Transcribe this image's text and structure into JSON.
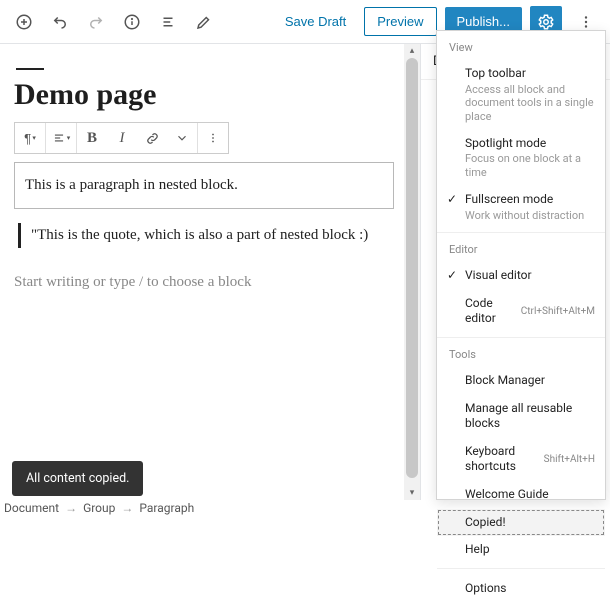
{
  "topbar": {
    "save_draft": "Save Draft",
    "preview": "Preview",
    "publish": "Publish..."
  },
  "editor": {
    "title": "Demo page",
    "paragraph": "This is a paragraph in nested block.",
    "quote": "\"This is the quote, which is also a part of nested block :)",
    "placeholder": "Start writing or type / to choose a block"
  },
  "toolbar": {
    "pilcrow": "¶",
    "bold": "B",
    "italic": "I"
  },
  "sidebar": {
    "tab": "D"
  },
  "menu": {
    "sections": {
      "view": {
        "heading": "View",
        "items": [
          {
            "label": "Top toolbar",
            "desc": "Access all block and document tools in a single place",
            "checked": false
          },
          {
            "label": "Spotlight mode",
            "desc": "Focus on one block at a time",
            "checked": false
          },
          {
            "label": "Fullscreen mode",
            "desc": "Work without distraction",
            "checked": true
          }
        ]
      },
      "editor": {
        "heading": "Editor",
        "items": [
          {
            "label": "Visual editor",
            "checked": true
          },
          {
            "label": "Code editor",
            "shortcut": "Ctrl+Shift+Alt+M",
            "checked": false
          }
        ]
      },
      "tools": {
        "heading": "Tools",
        "items": [
          {
            "label": "Block Manager"
          },
          {
            "label": "Manage all reusable blocks"
          },
          {
            "label": "Keyboard shortcuts",
            "shortcut": "Shift+Alt+H"
          },
          {
            "label": "Welcome Guide"
          },
          {
            "label": "Copied!",
            "highlight": true
          },
          {
            "label": "Help"
          }
        ]
      },
      "options": {
        "items": [
          {
            "label": "Options"
          }
        ]
      }
    }
  },
  "snackbar": {
    "text": "All content copied."
  },
  "breadcrumb": [
    "Document",
    "Group",
    "Paragraph"
  ]
}
